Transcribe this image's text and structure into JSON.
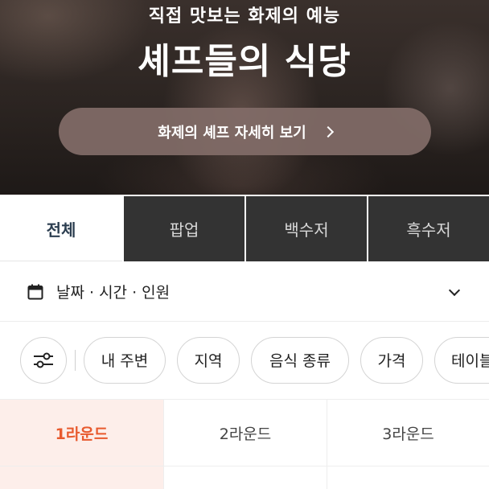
{
  "banner": {
    "subtitle": "직접 맛보는 화제의 예능",
    "title": "셰프들의 식당",
    "cta_label": "화제의 셰프 자세히 보기"
  },
  "category_tabs": [
    {
      "label": "전체",
      "active": true
    },
    {
      "label": "팝업",
      "active": false
    },
    {
      "label": "백수저",
      "active": false
    },
    {
      "label": "흑수저",
      "active": false
    }
  ],
  "booking": {
    "label": "날짜 · 시간 · 인원",
    "icons": [
      "calendar-icon",
      "chevron-down-icon"
    ]
  },
  "filters": {
    "chips": [
      "내 주변",
      "지역",
      "음식 종류",
      "가격",
      "테이블"
    ]
  },
  "rounds": [
    {
      "label": "1라운드",
      "active": true
    },
    {
      "label": "2라운드",
      "active": false
    },
    {
      "label": "3라운드",
      "active": false
    }
  ],
  "colors": {
    "accent": "#e85a2e",
    "accent_bg": "#fdeeea",
    "tab_dark": "#333333",
    "cta_bg": "#826c68"
  }
}
